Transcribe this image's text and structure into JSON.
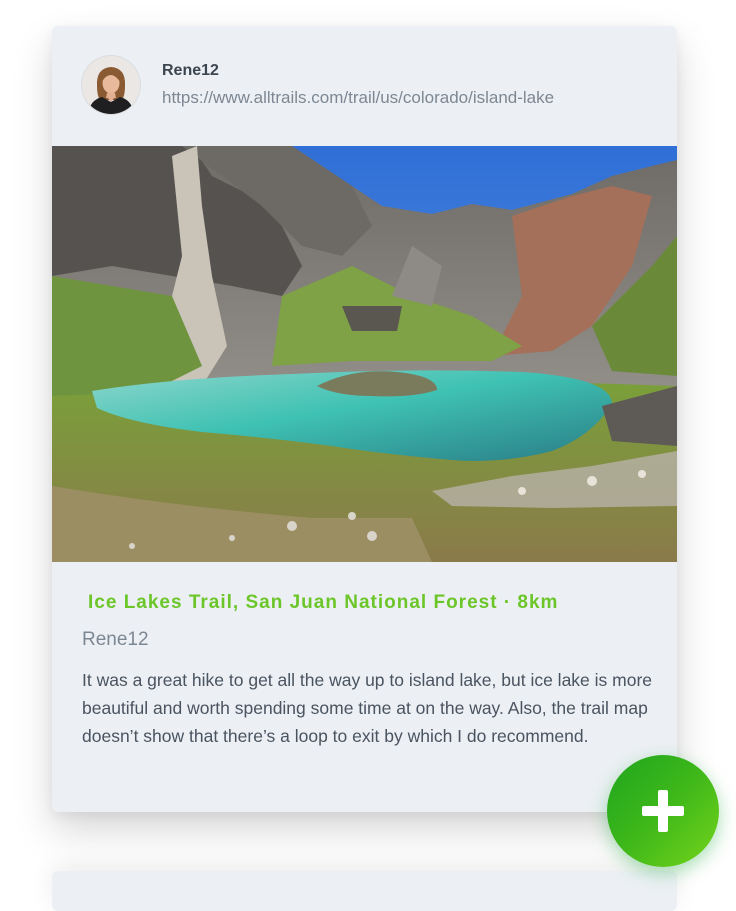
{
  "post": {
    "author": "Rene12",
    "url": "https://www.alltrails.com/trail/us/colorado/island-lake",
    "trail_title": "Ice Lakes Trail, San Juan National Forest · 8km",
    "review_author": "Rene12",
    "review_text": "It was a great hike to get all the way up to island lake, but ice lake is more beautiful and worth spending some time at on the way. Also, the trail map doesn’t show that there’s a loop to exit by which I do recommend."
  },
  "fab": {
    "icon": "plus-icon",
    "color_start": "#1ea51e",
    "color_end": "#75d41b"
  },
  "colors": {
    "card_background": "#ecf0f4",
    "title_green": "#6cc62a",
    "muted_text": "#7d8793",
    "body_text": "#4a5360"
  }
}
